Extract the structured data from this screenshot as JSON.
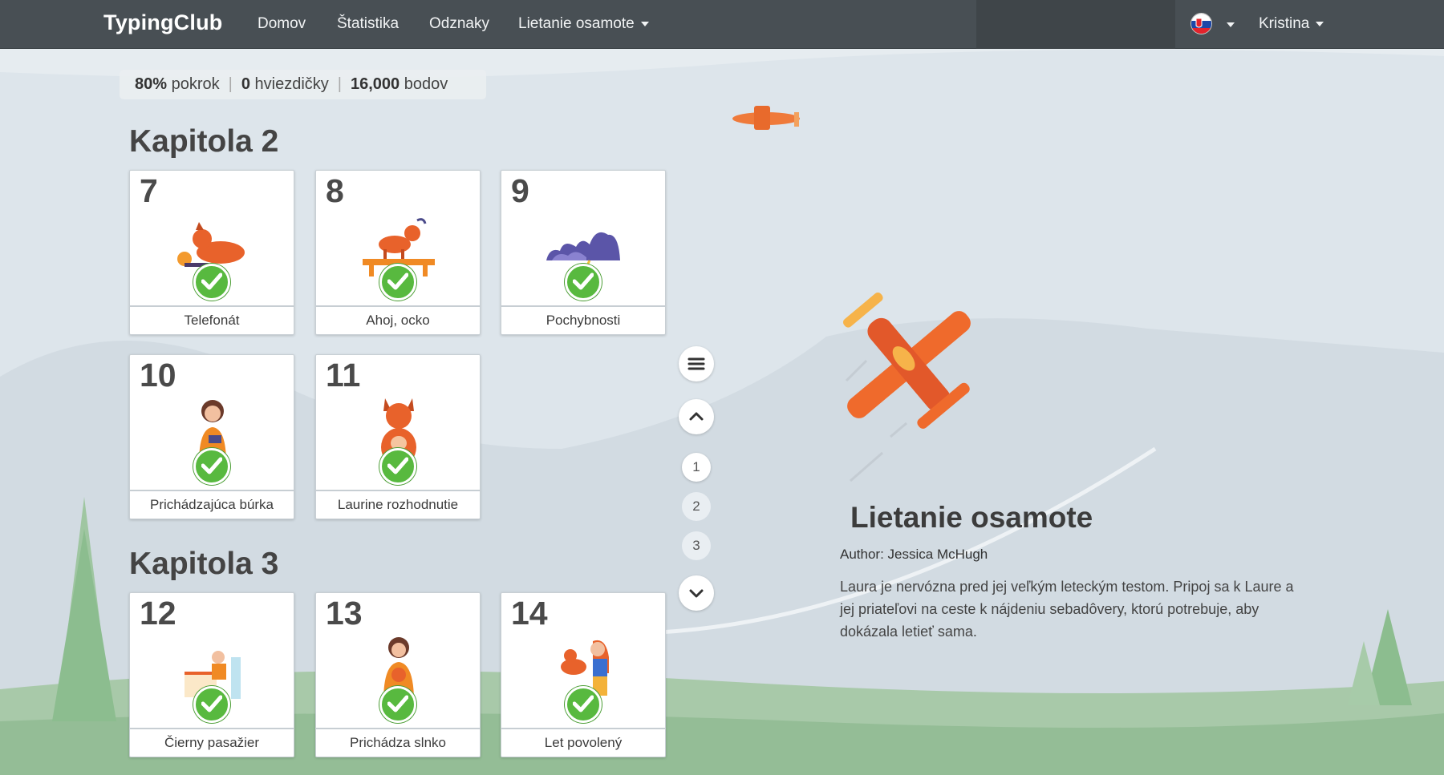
{
  "nav": {
    "brand": "TypingClub",
    "links": [
      "Domov",
      "Štatistika",
      "Odznaky"
    ],
    "dropdown": "Lietanie osamote",
    "user": "Kristina"
  },
  "stats": {
    "progress_value": "80%",
    "progress_label": "pokrok",
    "stars_value": "0",
    "stars_label": "hviezdičky",
    "points_value": "16,000",
    "points_label": "bodov"
  },
  "chapters": [
    {
      "title": "Kapitola 2",
      "lessons": [
        {
          "number": "7",
          "label": "Telefonát",
          "completed": true
        },
        {
          "number": "8",
          "label": "Ahoj, ocko",
          "completed": true
        },
        {
          "number": "9",
          "label": "Pochybnosti",
          "completed": true
        },
        {
          "number": "10",
          "label": "Prichádzajúca búrka",
          "completed": true
        },
        {
          "number": "11",
          "label": "Laurine rozhodnutie",
          "completed": true
        }
      ]
    },
    {
      "title": "Kapitola 3",
      "lessons": [
        {
          "number": "12",
          "label": "Čierny pasažier",
          "completed": true
        },
        {
          "number": "13",
          "label": "Prichádza slnko",
          "completed": true
        },
        {
          "number": "14",
          "label": "Let povolený",
          "completed": true
        }
      ]
    }
  ],
  "pager": {
    "pages": [
      "1",
      "2",
      "3"
    ],
    "active": "1"
  },
  "detail": {
    "title": "Lietanie osamote",
    "author": "Author: Jessica McHugh",
    "description": "Laura je nervózna pred jej veľkým leteckým testom. Pripoj sa k Laure a jej priateľovi na ceste k nájdeniu sebadôvery, ktorú potrebuje, aby dokázala letieť sama."
  },
  "colors": {
    "navbar": "#484f54",
    "check": "#58b93f",
    "plane": "#ef6a2c"
  }
}
